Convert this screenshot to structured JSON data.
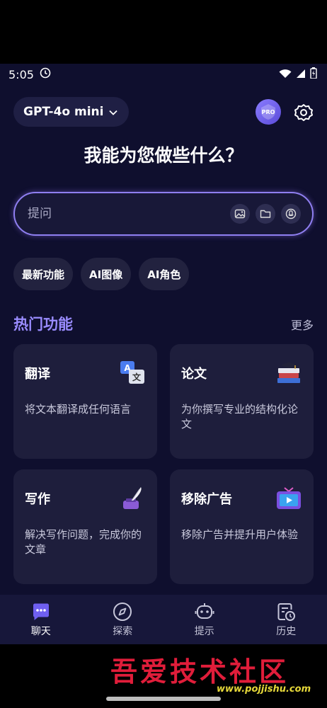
{
  "status": {
    "time": "5:05"
  },
  "header": {
    "model_label": "GPT-4o mini",
    "pro_label": "PRO"
  },
  "headline": "我能为您做些什么？",
  "search": {
    "placeholder": "提问"
  },
  "chips": [
    "最新功能",
    "AI图像",
    "AI角色"
  ],
  "section": {
    "title": "热门功能",
    "more": "更多"
  },
  "cards": [
    {
      "title": "翻译",
      "desc": "将文本翻译成任何语言",
      "icon": "translate-icon"
    },
    {
      "title": "论文",
      "desc": "为你撰写专业的结构化论文",
      "icon": "books-icon"
    },
    {
      "title": "写作",
      "desc": "解决写作问题，完成你的文章",
      "icon": "ink-quill-icon"
    },
    {
      "title": "移除广告",
      "desc": "移除广告并提升用户体验",
      "icon": "tv-ad-icon"
    }
  ],
  "nav": [
    {
      "label": "聊天",
      "icon": "chat-icon",
      "active": true
    },
    {
      "label": "探索",
      "icon": "compass-icon",
      "active": false
    },
    {
      "label": "提示",
      "icon": "robot-icon",
      "active": false
    },
    {
      "label": "历史",
      "icon": "history-icon",
      "active": false
    }
  ],
  "watermark": {
    "text": "吾爱技术社区",
    "url": "www.pojjishu.com"
  },
  "colors": {
    "accent": "#9a8cff",
    "background": "#0f0f2e",
    "card": "#1e1e3c",
    "watermark": "#e01d3a"
  }
}
